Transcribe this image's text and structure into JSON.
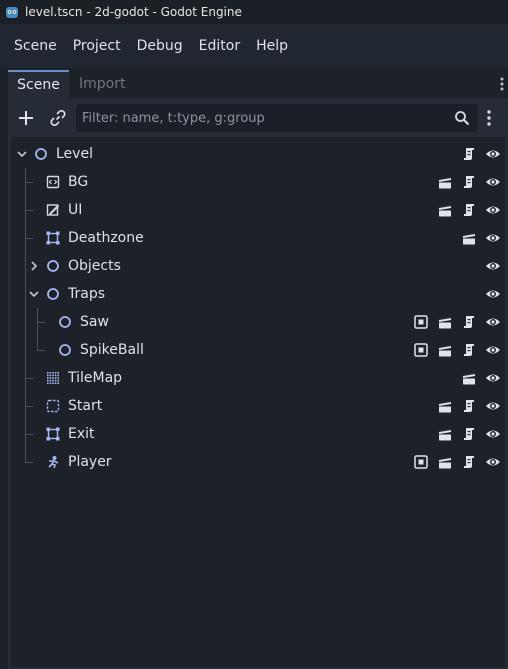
{
  "window": {
    "title": "level.tscn - 2d-godot - Godot Engine"
  },
  "menu": [
    "Scene",
    "Project",
    "Debug",
    "Editor",
    "Help"
  ],
  "dock": {
    "tabs": [
      {
        "label": "Scene",
        "active": true
      },
      {
        "label": "Import",
        "active": false
      }
    ],
    "filter": {
      "placeholder": "Filter: name, t:type, g:group",
      "value": ""
    }
  },
  "tree": [
    {
      "label": "Level",
      "icon": "node2d-icon",
      "depth": 0,
      "expander": "expanded",
      "badges": [
        "script-icon",
        "visibility-icon"
      ]
    },
    {
      "label": "BG",
      "icon": "parallax-icon",
      "depth": 1,
      "expander": null,
      "badges": [
        "instance-icon",
        "script-icon",
        "visibility-icon"
      ]
    },
    {
      "label": "UI",
      "icon": "canvas-icon",
      "depth": 1,
      "expander": null,
      "badges": [
        "instance-icon",
        "script-icon",
        "visibility-icon"
      ]
    },
    {
      "label": "Deathzone",
      "icon": "area2d-icon",
      "depth": 1,
      "expander": null,
      "badges": [
        "instance-icon",
        "visibility-icon"
      ]
    },
    {
      "label": "Objects",
      "icon": "node2d-icon",
      "depth": 1,
      "expander": "collapsed",
      "badges": [
        "visibility-icon"
      ]
    },
    {
      "label": "Traps",
      "icon": "node2d-icon",
      "depth": 1,
      "expander": "expanded",
      "badges": [
        "visibility-icon"
      ]
    },
    {
      "label": "Saw",
      "icon": "node2d-icon",
      "depth": 2,
      "expander": null,
      "badges": [
        "signal-icon",
        "instance-icon",
        "script-icon",
        "visibility-icon"
      ]
    },
    {
      "label": "SpikeBall",
      "icon": "node2d-icon",
      "depth": 2,
      "expander": null,
      "badges": [
        "signal-icon",
        "instance-icon",
        "script-icon",
        "visibility-icon"
      ]
    },
    {
      "label": "TileMap",
      "icon": "tilemap-icon",
      "depth": 1,
      "expander": null,
      "badges": [
        "instance-icon",
        "visibility-icon"
      ]
    },
    {
      "label": "Start",
      "icon": "marker-icon",
      "depth": 1,
      "expander": null,
      "badges": [
        "instance-icon",
        "script-icon",
        "visibility-icon"
      ]
    },
    {
      "label": "Exit",
      "icon": "area2d-icon",
      "depth": 1,
      "expander": null,
      "badges": [
        "instance-icon",
        "script-icon",
        "visibility-icon"
      ]
    },
    {
      "label": "Player",
      "icon": "character-icon",
      "depth": 1,
      "expander": null,
      "badges": [
        "signal-icon",
        "instance-icon",
        "script-icon",
        "visibility-icon"
      ]
    }
  ],
  "colors": {
    "accent": "#6b8fc7",
    "node_icon": "#a5b7f3",
    "background": "#1d2229"
  }
}
